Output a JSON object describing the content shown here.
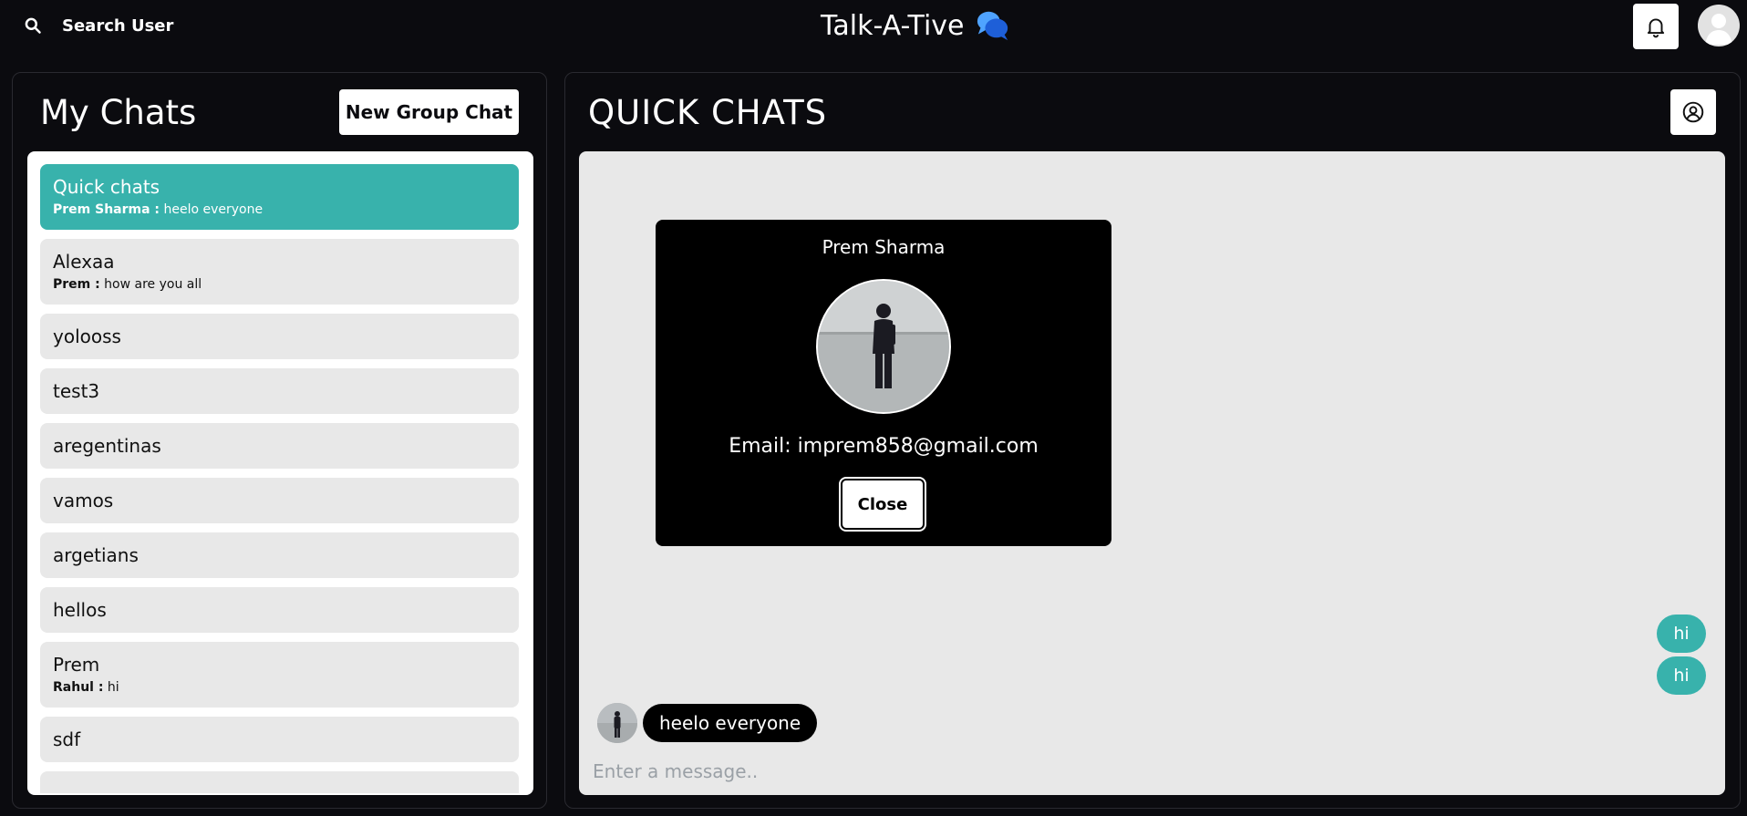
{
  "header": {
    "search_label": "Search User",
    "app_title": "Talk-A-Tive"
  },
  "sidebar": {
    "title": "My Chats",
    "new_group_label": "New Group Chat",
    "chats": [
      {
        "name": "Quick chats",
        "sender": "Prem Sharma :",
        "last": " heelo everyone",
        "active": true
      },
      {
        "name": "Alexaa",
        "sender": "Prem :",
        "last": " how are you all"
      },
      {
        "name": "yolooss"
      },
      {
        "name": "test3"
      },
      {
        "name": "aregentinas"
      },
      {
        "name": "vamos"
      },
      {
        "name": "argetians"
      },
      {
        "name": "hellos"
      },
      {
        "name": "Prem",
        "sender": "Rahul :",
        "last": " hi"
      },
      {
        "name": "sdf"
      }
    ]
  },
  "chat": {
    "title": "QUICK CHATS",
    "messages_out": [
      "hi",
      "hi"
    ],
    "message_in": "heelo everyone",
    "input_placeholder": "Enter a message.."
  },
  "profile_modal": {
    "name": "Prem Sharma",
    "email": "Email: imprem858@gmail.com",
    "close_label": "Close"
  },
  "colors": {
    "background": "#0b0b0f",
    "accent": "#38b2ac",
    "panel": "#e8e8e8"
  }
}
